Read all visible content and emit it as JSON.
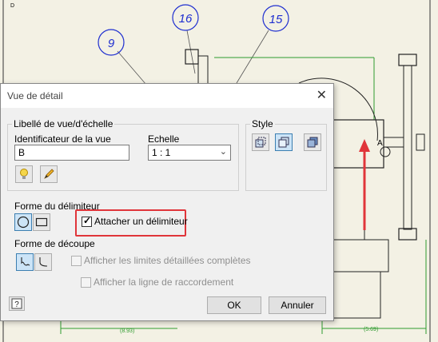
{
  "drawing": {
    "balloons": [
      "9",
      "16",
      "15"
    ],
    "detail_label": "A",
    "dims": [
      "(8.93)",
      "(5.69)"
    ],
    "corner_label": "D",
    "accent_color": "#e0353a"
  },
  "dialog": {
    "title": "Vue de détail",
    "close_icon": "✕",
    "label_group": {
      "title": "Libellé de vue/d'échelle",
      "identifier_label": "Identificateur de la vue",
      "identifier_value": "B",
      "scale_label": "Echelle",
      "scale_value": "1 : 1"
    },
    "style_group": {
      "title": "Style"
    },
    "fence_shape": {
      "title": "Forme du délimiteur",
      "attach_label": "Attacher un délimiteur",
      "attach_checked": true
    },
    "cutout_shape": {
      "title": "Forme de découpe",
      "full_boundary_label": "Afficher les limites détaillées complètes",
      "connection_line_label": "Afficher la ligne de raccordement"
    },
    "buttons": {
      "ok": "OK",
      "cancel": "Annuler"
    }
  }
}
